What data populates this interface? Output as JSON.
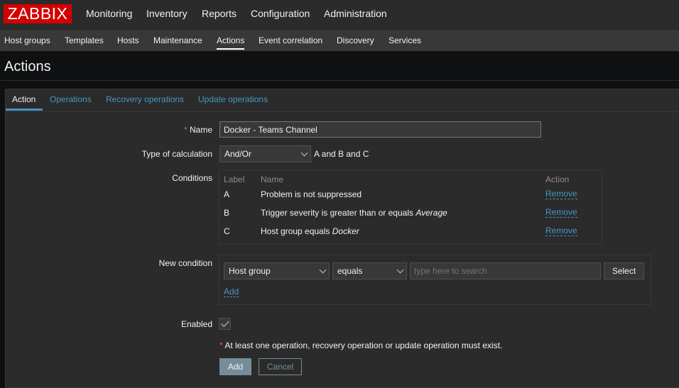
{
  "brand": {
    "logo": "ZABBIX",
    "color": "#d40000"
  },
  "main_menu": [
    "Monitoring",
    "Inventory",
    "Reports",
    "Configuration",
    "Administration"
  ],
  "sub_menu": [
    "Host groups",
    "Templates",
    "Hosts",
    "Maintenance",
    "Actions",
    "Event correlation",
    "Discovery",
    "Services"
  ],
  "page": {
    "title": "Actions"
  },
  "tabs": [
    "Action",
    "Operations",
    "Recovery operations",
    "Update operations"
  ],
  "form": {
    "name_label": "Name",
    "name_value": "Docker - Teams Channel",
    "calc_label": "Type of calculation",
    "calc_value": "And/Or",
    "calc_expr": "A and B and C",
    "conditions_label": "Conditions",
    "conditions_headers": {
      "label": "Label",
      "name": "Name",
      "action": "Action"
    },
    "conditions": [
      {
        "label": "A",
        "text": "Problem is not suppressed",
        "value": "",
        "action": "Remove"
      },
      {
        "label": "B",
        "text": "Trigger severity is greater than or equals ",
        "value": "Average",
        "action": "Remove"
      },
      {
        "label": "C",
        "text": "Host group equals ",
        "value": "Docker",
        "action": "Remove"
      }
    ],
    "new_condition_label": "New condition",
    "new_condition": {
      "type": "Host group",
      "operator": "equals",
      "search_placeholder": "type here to search",
      "select_label": "Select",
      "add_link": "Add"
    },
    "enabled_label": "Enabled",
    "enabled": true,
    "note_asterisk": "*",
    "note": "At least one operation, recovery operation or update operation must exist.",
    "add_button": "Add",
    "cancel_button": "Cancel"
  }
}
